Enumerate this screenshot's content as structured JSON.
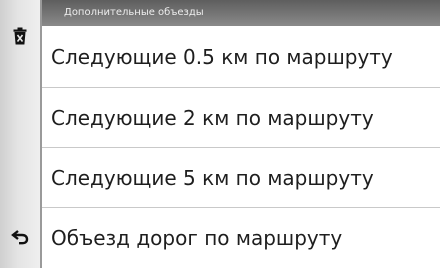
{
  "header": {
    "title": "Дополнительные объезды"
  },
  "side": {
    "top_icon": "trash-icon",
    "bottom_icon": "back-arrow-icon"
  },
  "options": [
    {
      "label": "Следующие 0.5 км по маршруту"
    },
    {
      "label": "Следующие 2 км по маршруту"
    },
    {
      "label": "Следующие 5 км по маршруту"
    },
    {
      "label": "Объезд дорог по маршруту"
    }
  ]
}
